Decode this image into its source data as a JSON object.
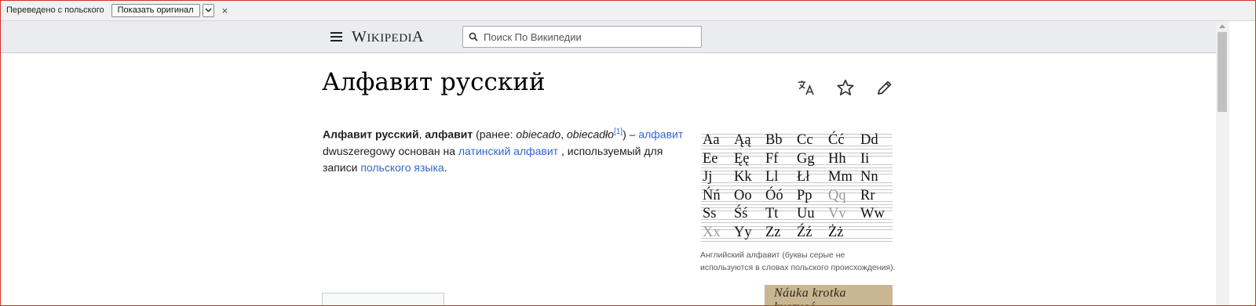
{
  "translate_bar": {
    "label": "Переведено с польского",
    "show_original": "Показать оригинал",
    "close": "×"
  },
  "header": {
    "logo_first": "W",
    "logo_rest": "IKIPEDI",
    "logo_last": "A",
    "search_placeholder": "Поиск По Википедии"
  },
  "article": {
    "title": "Алфавит русский",
    "actions": [
      "translate-icon",
      "star-icon",
      "pencil-icon"
    ],
    "para": {
      "b1": "Алфавит русский",
      "sep": ", ",
      "b2": "алфавит",
      "t1": " (ранее: ",
      "i1": "obiecado",
      "t2": ", ",
      "i2": "obiecadło",
      "sup": "[1]",
      "t3": ") – ",
      "l1": "алфавит",
      "t4": " dwuszeregowy основан на ",
      "l2": "латинский алфавит ",
      "t5": ", используемый для записи ",
      "l3": "польского языка",
      "t6": "."
    }
  },
  "alphabet": {
    "rows": [
      [
        "Aa",
        "Ąą",
        "Bb",
        "Cc",
        "Ćć",
        "Dd"
      ],
      [
        "Ee",
        "Ęę",
        "Ff",
        "Gg",
        "Hh",
        "Ii"
      ],
      [
        "Jj",
        "Kk",
        "Ll",
        "Łł",
        "Mm",
        "Nn"
      ],
      [
        "Ńń",
        "Oo",
        "Óó",
        "Pp",
        "Qq",
        "Rr"
      ],
      [
        "Ss",
        "Śś",
        "Tt",
        "Uu",
        "Vv",
        "Ww"
      ],
      [
        "Xx",
        "Yy",
        "Zz",
        "Źź",
        "Żż",
        ""
      ]
    ],
    "gray": [
      "Qq",
      "Vv",
      "Xx"
    ],
    "caption": "Английский алфавит (буквы серые не используются в словах польского происхождения)."
  },
  "thumb_text": "Náuka krotka kuszycá-",
  "colors": {
    "link": "#3366cc",
    "header_bg": "#eaecf0",
    "frame": "#d93025"
  }
}
